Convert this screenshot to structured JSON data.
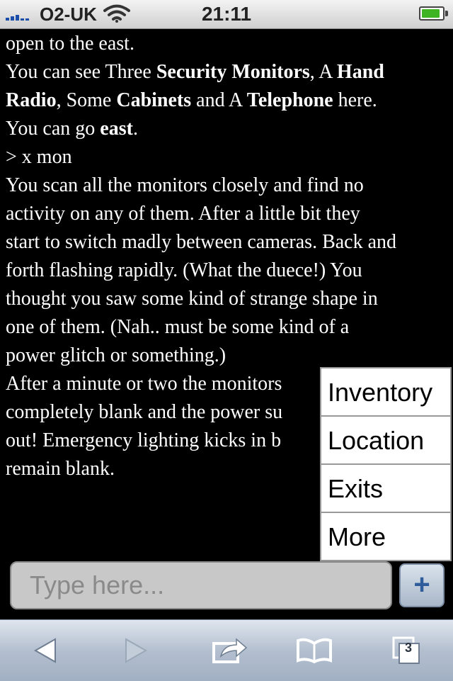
{
  "status_bar": {
    "carrier": "O2-UK",
    "time": "21:11",
    "battery_level": 0.9
  },
  "game": {
    "lines": [
      [
        {
          "t": "open to the east."
        }
      ],
      [
        {
          "t": "You can see Three "
        },
        {
          "t": "Security Monitors",
          "b": true
        },
        {
          "t": ", A "
        },
        {
          "t": "Hand",
          "b": true
        }
      ],
      [
        {
          "t": "Radio",
          "b": true
        },
        {
          "t": ", Some "
        },
        {
          "t": "Cabinets",
          "b": true
        },
        {
          "t": " and A "
        },
        {
          "t": "Telephone",
          "b": true
        },
        {
          "t": " here."
        }
      ],
      [
        {
          "t": "You can go "
        },
        {
          "t": "east",
          "b": true
        },
        {
          "t": "."
        }
      ],
      [
        {
          "t": " "
        }
      ],
      [
        {
          "t": "> x mon"
        }
      ],
      [
        {
          "t": "You scan all the monitors closely and find no"
        }
      ],
      [
        {
          "t": "activity on any of them. After a little bit they"
        }
      ],
      [
        {
          "t": "start to switch madly between cameras. Back and"
        }
      ],
      [
        {
          "t": "forth flashing rapidly. (What the duece!) You"
        }
      ],
      [
        {
          "t": "thought you saw some kind of strange shape in"
        }
      ],
      [
        {
          "t": "one of them. (Nah.. must be some kind of a"
        }
      ],
      [
        {
          "t": "power glitch or something.)"
        }
      ],
      [
        {
          "t": "After a minute or two the monitors"
        }
      ],
      [
        {
          "t": "completely blank and the power su"
        }
      ],
      [
        {
          "t": "out! Emergency lighting kicks in b"
        }
      ],
      [
        {
          "t": "remain blank."
        }
      ]
    ]
  },
  "menu": {
    "items": [
      {
        "label": "Inventory"
      },
      {
        "label": "Location"
      },
      {
        "label": "Exits"
      },
      {
        "label": "More"
      }
    ]
  },
  "input": {
    "placeholder": "Type here...",
    "value": "",
    "add_label": "+"
  },
  "toolbar": {
    "icons": [
      "back-icon",
      "forward-icon",
      "share-icon",
      "bookmarks-icon",
      "tabs-icon"
    ],
    "tabs_count": "3"
  }
}
